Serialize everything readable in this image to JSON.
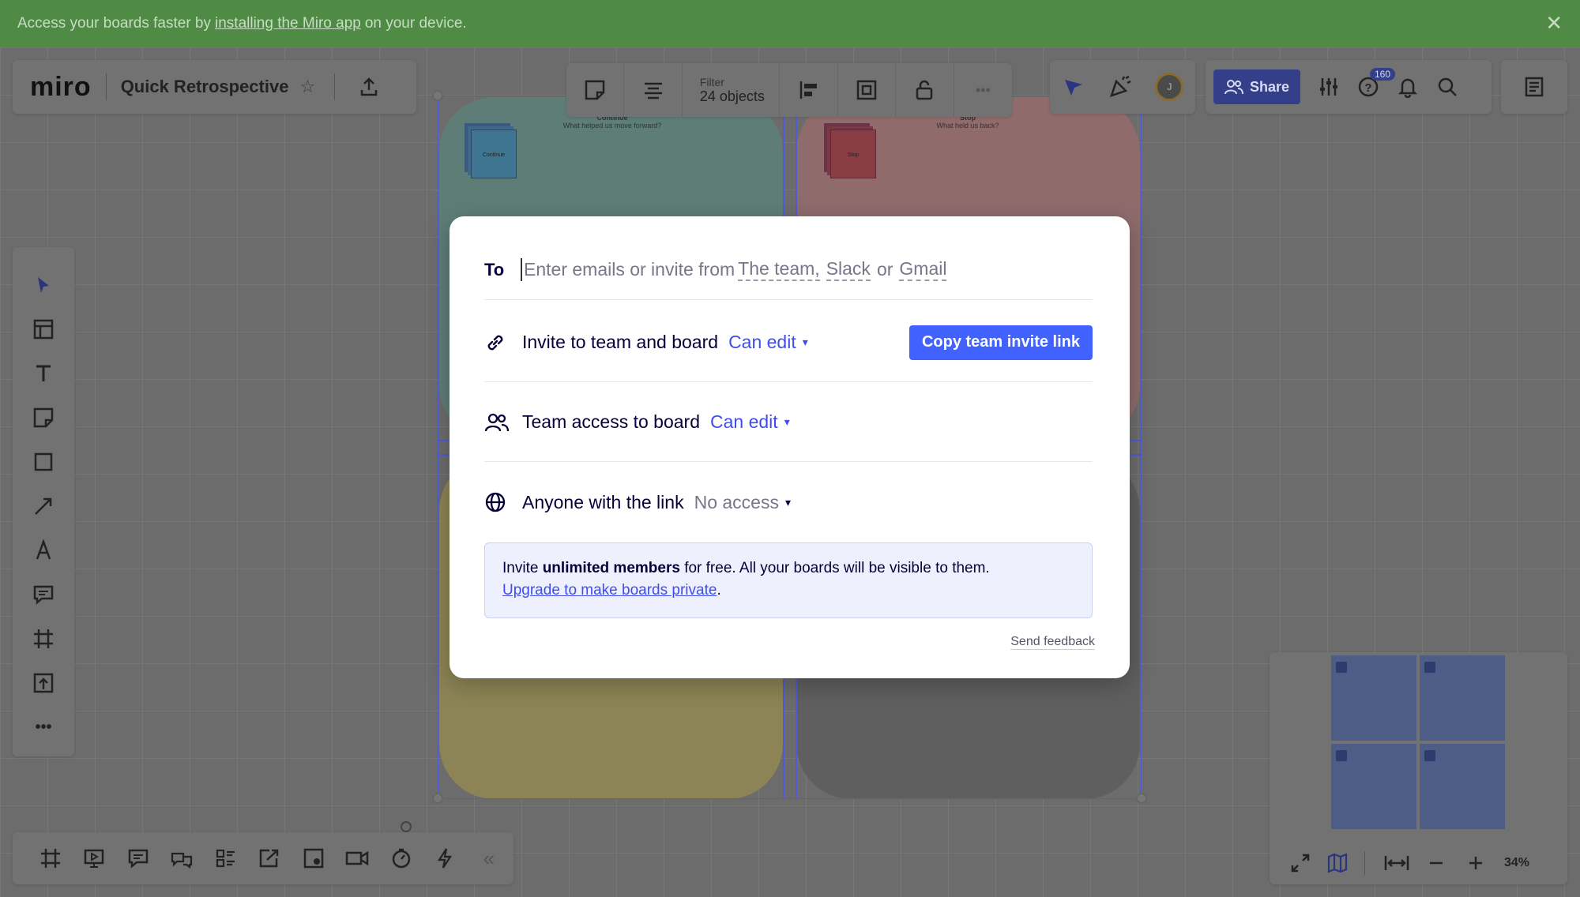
{
  "banner": {
    "text_before": "Access your boards faster by",
    "link": "installing the Miro app",
    "text_after": "on your device.",
    "close": "✕"
  },
  "header": {
    "logo": "miro",
    "board_title": "Quick Retrospective",
    "star": "☆",
    "upload": "⇪"
  },
  "board": {
    "q1_title": "Continue",
    "q1_sub": "What helped us move forward?",
    "q1_note": "Continue",
    "q2_title": "Stop",
    "q2_sub": "What held us back?",
    "q2_note": "Stop"
  },
  "context_toolbar": {
    "filter_key": "Filter",
    "filter_value": "24 objects",
    "more": "•••"
  },
  "collab": {
    "avatar_initial": "J",
    "share_label": "Share",
    "help_badge": "160"
  },
  "left_tools": {
    "more": "•••"
  },
  "bottom_bar": {
    "collapse": "«"
  },
  "minimap": {
    "zoom": "34%"
  },
  "share_modal": {
    "to_label": "To",
    "to_placeholder_prefix": "Enter emails or invite from",
    "to_team": "The team,",
    "to_slack": "Slack",
    "to_or": "or",
    "to_gmail": "Gmail",
    "invite_label": "Invite to team and board",
    "invite_perm": "Can edit",
    "copy_button": "Copy team invite link",
    "team_label": "Team access to board",
    "team_perm": "Can edit",
    "anyone_label": "Anyone with the link",
    "anyone_perm": "No access",
    "info_prefix": "Invite",
    "info_bold": "unlimited members",
    "info_rest": "for free. All your boards will be visible to them.",
    "info_link": "Upgrade to make boards private",
    "info_end": ".",
    "feedback": "Send feedback"
  },
  "colors": {
    "accent": "#4262ff",
    "banner": "#4f8b45",
    "share": "#343f8a"
  }
}
